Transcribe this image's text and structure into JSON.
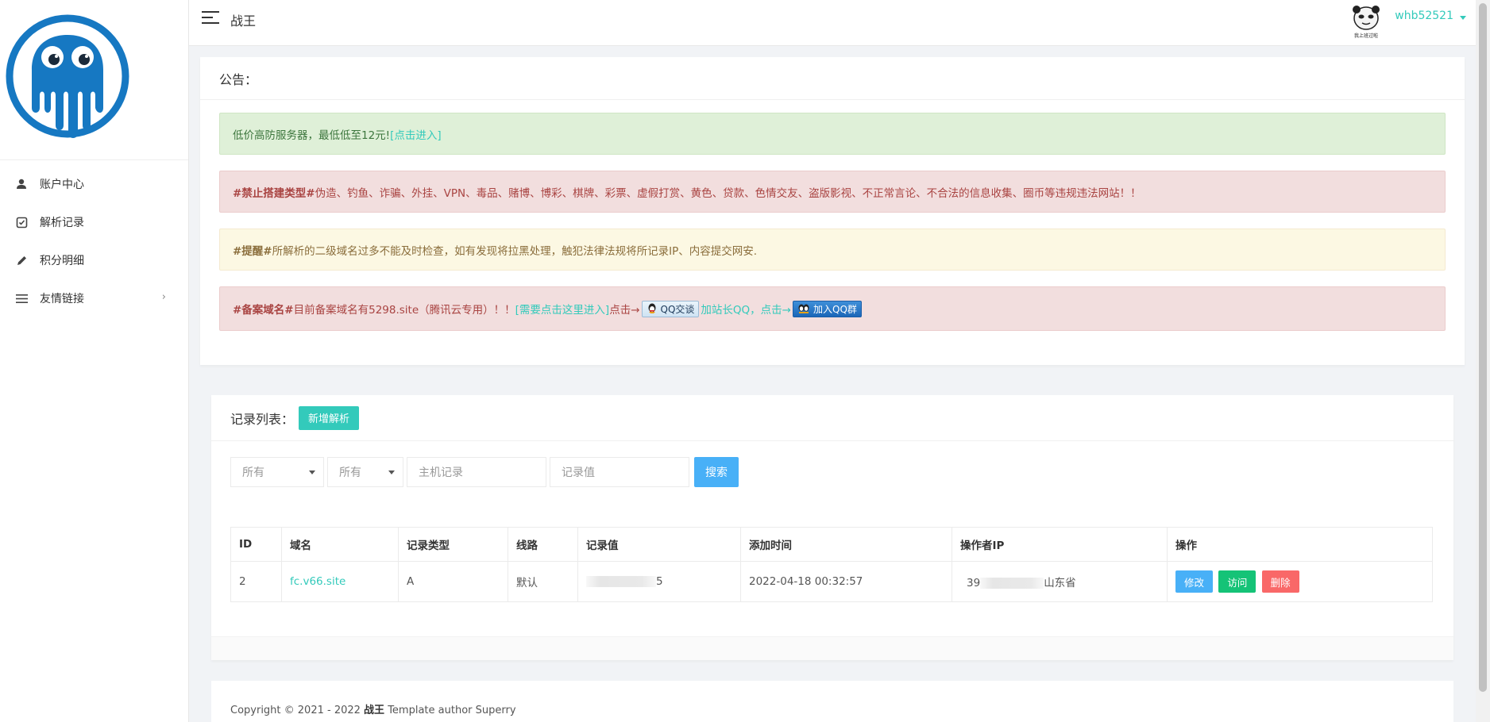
{
  "topbar": {
    "site_title": "战王",
    "username": "whb52521",
    "avatar_caption": "我上班过啦"
  },
  "sidebar": {
    "items": [
      {
        "label": "账户中心",
        "icon": "user-icon"
      },
      {
        "label": "解析记录",
        "icon": "note-icon"
      },
      {
        "label": "积分明细",
        "icon": "pencil-icon"
      },
      {
        "label": "友情链接",
        "icon": "list-icon",
        "has_submenu": true
      }
    ]
  },
  "notice": {
    "title": "公告：",
    "alerts": {
      "success": {
        "text": "低价高防服务器，最低低至12元! ",
        "link": "[点击进入]"
      },
      "danger1": {
        "tag": "#禁止搭建类型#",
        "text": " 伪造、钓鱼、诈骗、外挂、VPN、毒品、赌博、博彩、棋牌、彩票、虚假打赏、黄色、贷款、色情交友、盗版影视、不正常言论、不合法的信息收集、圈币等违规违法网站！！"
      },
      "warning": {
        "tag": "#提醒#",
        "text": " 所解析的二级域名过多不能及时检查，如有发现将拉黑处理，触犯法律法规将所记录IP、内容提交网安."
      },
      "danger2": {
        "tag": "#备案域名#",
        "text": " 目前备案域名有5298.site（腾讯云专用）！！",
        "link1": "[需要点击这里进入]",
        "text2": "点击→",
        "qq_chat": "QQ交谈",
        "link2": "加站长QQ，点击→",
        "qq_group": "加入QQ群"
      }
    }
  },
  "records": {
    "title": "记录列表：",
    "add_button": "新增解析",
    "filters": {
      "select1": "所有",
      "select2": "所有",
      "host_placeholder": "主机记录",
      "value_placeholder": "记录值",
      "search_button": "搜索"
    },
    "columns": [
      "ID",
      "域名",
      "记录类型",
      "线路",
      "记录值",
      "添加时间",
      "操作者IP",
      "操作"
    ],
    "rows": [
      {
        "id": "2",
        "domain": "fc.v66.site",
        "type": "A",
        "line": "默认",
        "value_suffix": "5",
        "added": "2022-04-18 00:32:57",
        "ip_prefix": "39",
        "ip_location": "山东省",
        "actions": {
          "edit": "修改",
          "visit": "访问",
          "delete": "删除"
        }
      }
    ]
  },
  "footer": {
    "prefix": "Copyright © 2021 - 2022 ",
    "brand": "战王",
    "suffix": " Template author Superry"
  },
  "colors": {
    "accent": "#33cabb",
    "info": "#48b0f7",
    "success": "#15c377",
    "danger": "#f96868",
    "logo": "#1678c2"
  }
}
